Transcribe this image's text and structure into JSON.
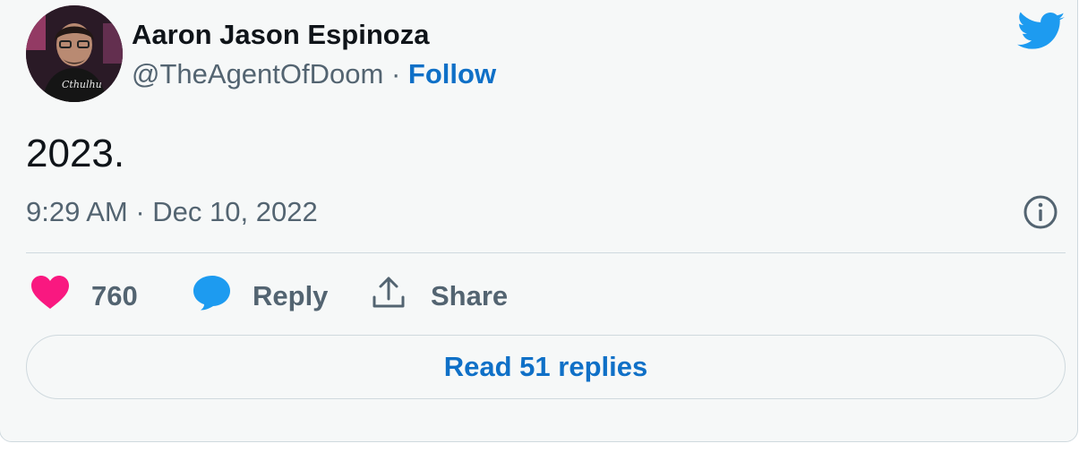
{
  "author": {
    "name": "Aaron Jason Espinoza",
    "handle": "@TheAgentOfDoom",
    "separator": "·",
    "follow_label": "Follow",
    "avatar_icon": "user-avatar"
  },
  "brand": {
    "icon": "twitter-bird-icon",
    "color": "#1d9bf0"
  },
  "tweet": {
    "text": "2023.",
    "timestamp": "9:29 AM · Dec 10, 2022"
  },
  "actions": {
    "like_count": "760",
    "reply_label": "Reply",
    "share_label": "Share"
  },
  "footer": {
    "read_replies_label": "Read 51 replies"
  },
  "colors": {
    "like": "#f91880",
    "reply": "#1d9bf0",
    "link": "#0f70c7",
    "muted": "#536471",
    "text": "#0f1419",
    "background": "#f6f8f8",
    "border": "#cfd9de"
  }
}
